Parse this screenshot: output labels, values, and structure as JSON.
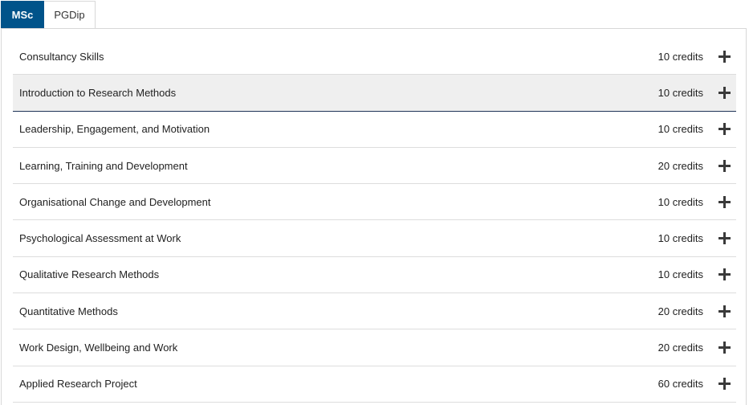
{
  "tabs": [
    {
      "label": "MSc",
      "active": true
    },
    {
      "label": "PGDip",
      "active": false
    }
  ],
  "modules": [
    {
      "title": "Consultancy Skills",
      "credits": "10 credits",
      "icon": "plus-icon"
    },
    {
      "title": "Introduction to Research Methods",
      "credits": "10 credits",
      "icon": "plus-icon",
      "highlighted": true
    },
    {
      "title": "Leadership, Engagement, and Motivation",
      "credits": "10 credits",
      "icon": "plus-icon"
    },
    {
      "title": "Learning, Training and Development",
      "credits": "20 credits",
      "icon": "plus-icon"
    },
    {
      "title": "Organisational Change and Development",
      "credits": "10 credits",
      "icon": "plus-icon"
    },
    {
      "title": "Psychological Assessment at Work",
      "credits": "10 credits",
      "icon": "plus-icon"
    },
    {
      "title": "Qualitative Research Methods",
      "credits": "10 credits",
      "icon": "plus-icon"
    },
    {
      "title": "Quantitative Methods",
      "credits": "20 credits",
      "icon": "plus-icon"
    },
    {
      "title": "Work Design, Wellbeing and Work",
      "credits": "20 credits",
      "icon": "plus-icon"
    },
    {
      "title": "Applied Research Project",
      "credits": "60 credits",
      "icon": "plus-icon"
    }
  ],
  "colors": {
    "active_tab_bg": "#00538a",
    "highlight_row_bg": "#efefef",
    "highlight_row_border": "#1f3457"
  }
}
